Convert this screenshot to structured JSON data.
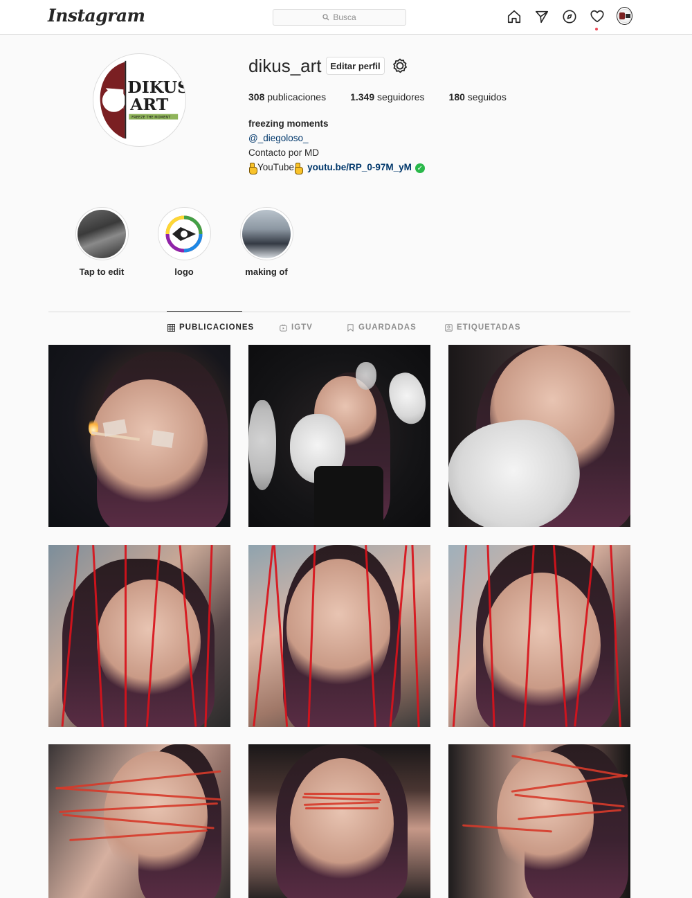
{
  "topnav": {
    "logo": "Instagram",
    "search_placeholder": "Busca"
  },
  "profile": {
    "username": "dikus_art",
    "edit_button": "Editar perfil",
    "stats": {
      "posts_count": "308",
      "posts_label": "publicaciones",
      "followers_count": "1.349",
      "followers_label": "seguidores",
      "following_count": "180",
      "following_label": "seguidos"
    },
    "bio": {
      "name": "freezing moments",
      "mention": "@_diegoloso_",
      "line3": "Contacto por MD",
      "youtube_text": "YouTube",
      "link": "youtu.be/RP_0-97M_yM"
    },
    "avatar_logo": {
      "line1": "DIKUS",
      "line2": "ART",
      "tagline": "FREEZE THE MOMENT"
    }
  },
  "highlights": [
    {
      "label": "Tap to edit"
    },
    {
      "label": "logo"
    },
    {
      "label": "making of"
    }
  ],
  "tabs": [
    {
      "label": "PUBLICACIONES",
      "active": true
    },
    {
      "label": "IGTV",
      "active": false
    },
    {
      "label": "GUARDADAS",
      "active": false
    },
    {
      "label": "ETIQUETADAS",
      "active": false
    }
  ],
  "posts_count_shown": 9,
  "colors": {
    "link": "#00376b",
    "border": "#dbdbdb",
    "text": "#262626",
    "muted": "#8e8e8e",
    "notification_dot": "#ed4956",
    "verified": "#2ab84a"
  }
}
